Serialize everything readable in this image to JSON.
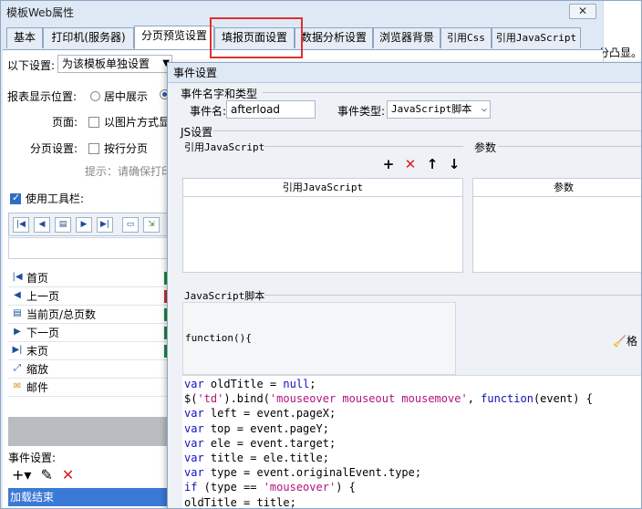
{
  "window": {
    "title": "模板Web属性",
    "close_glyph": "✕",
    "right_text": "分凸显。"
  },
  "tabs": [
    {
      "label": "基本"
    },
    {
      "label": "打印机(服务器)"
    },
    {
      "label": "分页预览设置"
    },
    {
      "label": "填报页面设置"
    },
    {
      "label": "数据分析设置"
    },
    {
      "label": "浏览器背景"
    },
    {
      "label": "引用Css"
    },
    {
      "label": "引用JavaScript"
    }
  ],
  "panel": {
    "apply_label": "以下设置:",
    "apply_value": "为该模板单独设置",
    "position_label": "报表显示位置:",
    "position_center": "居中展示",
    "page_label": "页面:",
    "page_as_image": "以图片方式显",
    "paging_label": "分页设置:",
    "paging_by_row": "按行分页",
    "hint": "提示：请确保打印",
    "use_toolbar": "使用工具栏:",
    "toolbar_items": [
      {
        "icon": "first-page-icon",
        "label": "首页"
      },
      {
        "icon": "prev-page-icon",
        "label": "上一页"
      },
      {
        "icon": "page-count-icon",
        "label": "当前页/总页数"
      },
      {
        "icon": "next-page-icon",
        "label": "下一页"
      },
      {
        "icon": "last-page-icon",
        "label": "末页"
      },
      {
        "icon": "zoom-icon",
        "label": "缩放"
      },
      {
        "icon": "mail-icon",
        "label": "邮件"
      }
    ],
    "event_settings_label": "事件设置:",
    "event_selected": "加载结束"
  },
  "dialog": {
    "title": "事件设置",
    "event_group": "事件名字和类型",
    "event_name_label": "事件名:",
    "event_name_value": "afterload",
    "event_type_label": "事件类型:",
    "event_type_value": "JavaScript脚本",
    "js_group": "JS设置",
    "ref_js_label": "引用JavaScript",
    "param_label": "参数",
    "ref_js_column": "引用JavaScript",
    "param_column": "参数",
    "script_label": "JavaScript脚本",
    "function_header": "function(){",
    "format_label": "格",
    "code_lines": [
      "var oldTitle = null;",
      "$('td').bind('mouseover mouseout mousemove', function(event) {",
      "var left = event.pageX;",
      "var top = event.pageY;",
      "var ele = event.target;",
      "var title = ele.title;",
      "var type = event.originalEvent.type;",
      "if (type == 'mouseover') {",
      "oldTitle = title;"
    ]
  },
  "colors": {
    "accent": "#3b79d6",
    "highlight_border": "#e03030",
    "keyword": "#1010b8",
    "string": "#b2127e"
  }
}
